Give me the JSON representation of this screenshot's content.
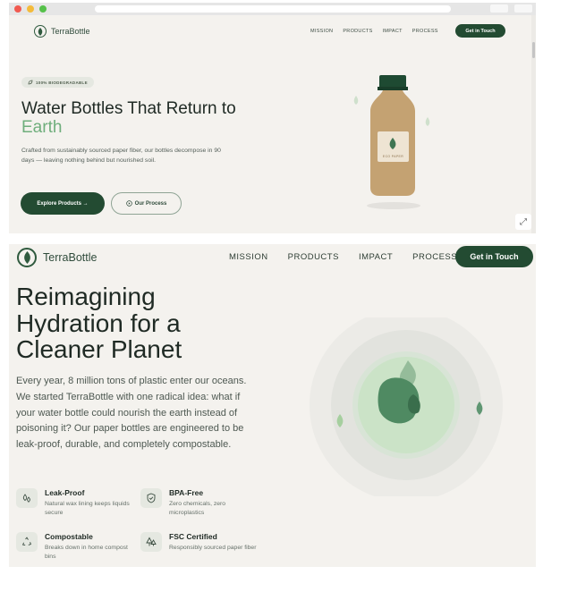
{
  "preview": {
    "logo_text": "TerraBottle",
    "nav": [
      "MISSION",
      "PRODUCTS",
      "IMPACT",
      "PROCESS"
    ],
    "cta": "Get in Touch",
    "badge": "100% BIODEGRADABLE",
    "heading_main": "Water Bottles That Return to",
    "heading_accent": "Earth",
    "paragraph": "Crafted from sustainably sourced paper fiber, our bottles decompose in 90 days — leaving nothing behind but nourished soil.",
    "primary_button": "Explore Products →",
    "secondary_button": "Our Process",
    "bottle_label": "ECO PAPER"
  },
  "mission": {
    "logo_text": "TerraBottle",
    "nav": [
      "MISSION",
      "PRODUCTS",
      "IMPACT",
      "PROCESS"
    ],
    "cta": "Get in Touch",
    "heading": [
      "Reimagining",
      "Hydration for a",
      "Cleaner Planet"
    ],
    "paragraph": "Every year, 8 million tons of plastic enter our oceans. We started TerraBottle with one radical idea: what if your water bottle could nourish the earth instead of poisoning it? Our paper bottles are engineered to be leak-proof, durable, and completely compostable.",
    "features": [
      {
        "title": "Leak-Proof",
        "desc": "Natural wax lining keeps liquids secure",
        "icon": "droplets-icon"
      },
      {
        "title": "BPA-Free",
        "desc": "Zero chemicals, zero microplastics",
        "icon": "shield-check-icon"
      },
      {
        "title": "Compostable",
        "desc": "Breaks down in home compost bins",
        "icon": "recycle-icon"
      },
      {
        "title": "FSC Certified",
        "desc": "Responsibly sourced paper fiber",
        "icon": "trees-icon"
      }
    ]
  },
  "colors": {
    "brand_dark_green": "#234b32",
    "accent_green": "#6fae7c",
    "background": "#f4f2ee"
  }
}
